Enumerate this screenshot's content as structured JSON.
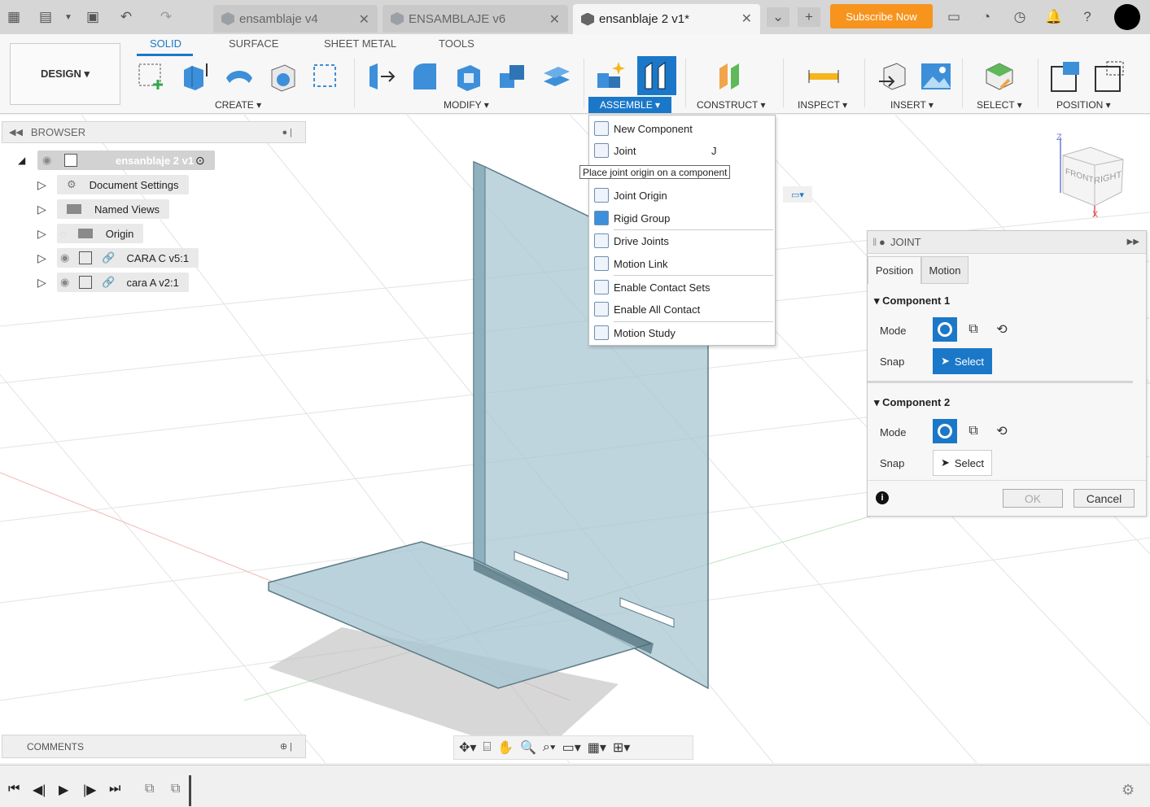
{
  "tabs": [
    {
      "label": "ensamblaje v4",
      "active": false
    },
    {
      "label": "ENSAMBLAJE v6",
      "active": false
    },
    {
      "label": "ensanblaje 2 v1*",
      "active": true
    }
  ],
  "header": {
    "subscribe_label": "Subscribe Now"
  },
  "ribbon": {
    "tabs": [
      "SOLID",
      "SURFACE",
      "SHEET METAL",
      "TOOLS"
    ],
    "design_label": "DESIGN ▾",
    "groups": {
      "create": "CREATE ▾",
      "modify": "MODIFY ▾",
      "assemble": "ASSEMBLE ▾",
      "construct": "CONSTRUCT ▾",
      "inspect": "INSPECT ▾",
      "insert": "INSERT ▾",
      "select": "SELECT ▾",
      "position": "POSITION ▾"
    }
  },
  "browser": {
    "title": "BROWSER",
    "root": "ensanblaje 2 v1",
    "items": [
      "Document Settings",
      "Named Views",
      "Origin",
      "CARA C v5:1",
      "cara A v2:1"
    ]
  },
  "assemble_menu": {
    "items": [
      {
        "label": "New Component",
        "shortcut": ""
      },
      {
        "label": "Joint",
        "shortcut": "J"
      },
      {
        "label": "Joint Origin",
        "shortcut": ""
      },
      {
        "label": "Rigid Group",
        "shortcut": ""
      },
      {
        "label": "Drive Joints",
        "shortcut": ""
      },
      {
        "label": "Motion Link",
        "shortcut": ""
      },
      {
        "label": "Enable Contact Sets",
        "shortcut": ""
      },
      {
        "label": "Enable All Contact",
        "shortcut": ""
      },
      {
        "label": "Motion Study",
        "shortcut": ""
      }
    ],
    "tooltip": "Place joint origin on a component"
  },
  "joint_panel": {
    "title": "JOINT",
    "tabs": [
      "Position",
      "Motion"
    ],
    "component1": {
      "title": "Component 1",
      "mode_label": "Mode",
      "snap_label": "Snap",
      "select_label": "Select"
    },
    "component2": {
      "title": "Component 2",
      "mode_label": "Mode",
      "snap_label": "Snap",
      "select_label": "Select"
    },
    "ok_label": "OK",
    "cancel_label": "Cancel"
  },
  "viewcube": {
    "front": "FRONT",
    "right": "RIGHT",
    "z": "Z",
    "x": "X"
  },
  "comments": {
    "title": "COMMENTS"
  },
  "colors": {
    "accent": "#1b78c8",
    "subscribe": "#f7941d",
    "body": "#9fbdc9"
  }
}
